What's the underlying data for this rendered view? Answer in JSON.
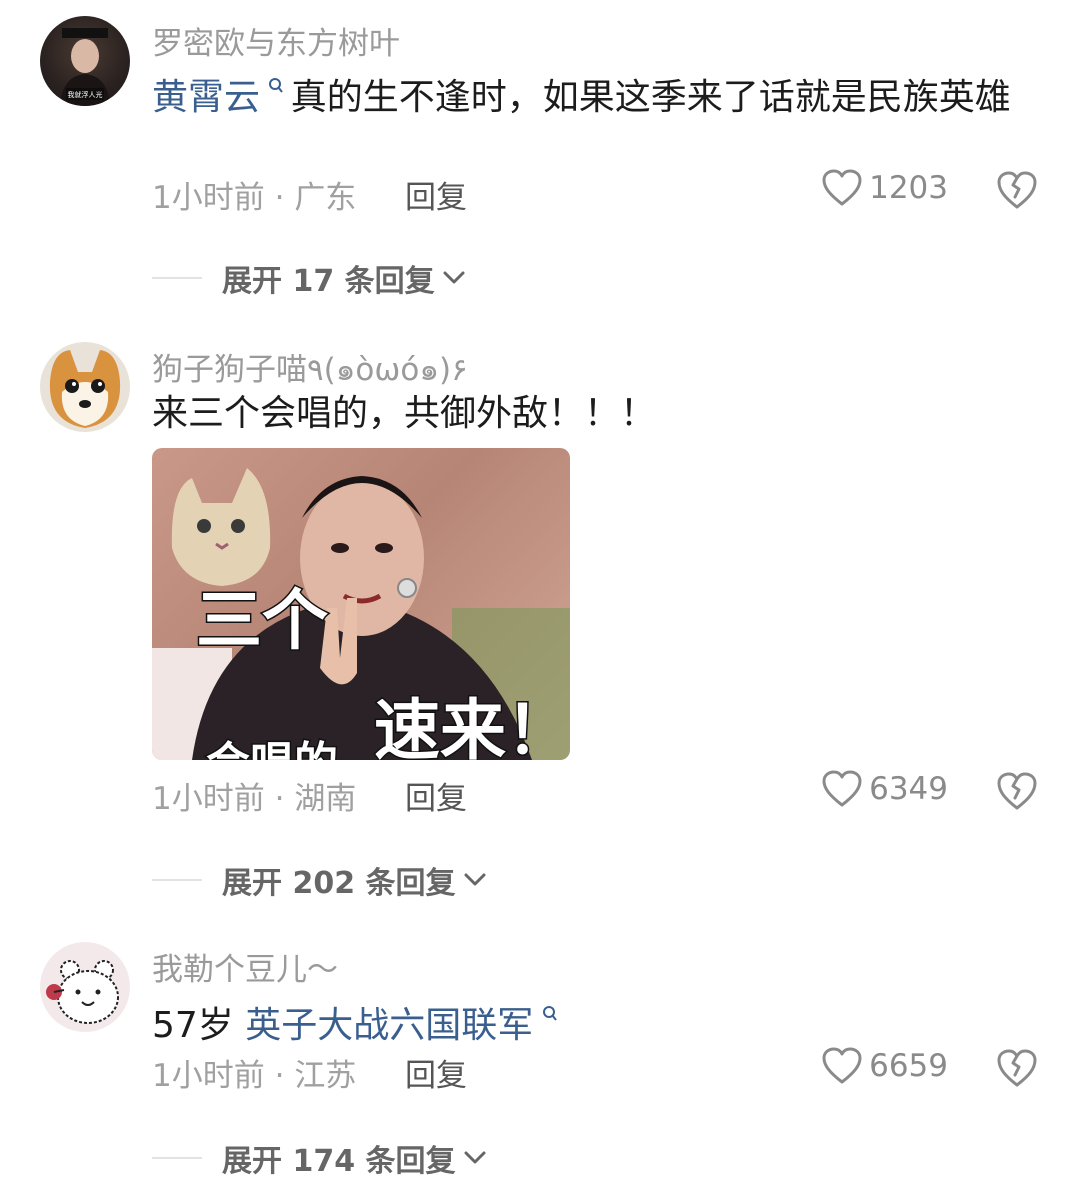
{
  "comments": [
    {
      "username": "罗密欧与东方树叶",
      "text_link": "黄霄云",
      "text_body": "真的生不逢时，如果这季来了话就是民族英雄",
      "avatar_caption": "我就浮人光",
      "time": "1小时前",
      "location": "广东",
      "reply_label": "回复",
      "likes": "1203",
      "expand_label": "展开 17 条回复"
    },
    {
      "username": "狗子狗子喵٩(๑òωó๑)۶",
      "text_body": "来三个会唱的，共御外敌！！！",
      "sticker": {
        "caption_top": "三个",
        "caption_bottom": "速来！",
        "caption_partial": "会唱的"
      },
      "time": "1小时前",
      "location": "湖南",
      "reply_label": "回复",
      "likes": "6349",
      "expand_label": "展开 202 条回复"
    },
    {
      "username": "我勒个豆儿～",
      "text_prefix": "57岁 ",
      "text_link": "英子大战六国联军",
      "time": "1小时前",
      "location": "江苏",
      "reply_label": "回复",
      "likes": "6659",
      "expand_label": "展开 174 条回复"
    }
  ],
  "meta_separator": "·",
  "search_glyph": "ℚ",
  "colors": {
    "link": "#3a5f8f",
    "meta": "#a0a0a0",
    "username": "#9a9a9a"
  },
  "icons": {
    "like": "heart-outline-icon",
    "dislike": "broken-heart-icon",
    "expand": "chevron-down-icon",
    "search": "search-icon"
  }
}
